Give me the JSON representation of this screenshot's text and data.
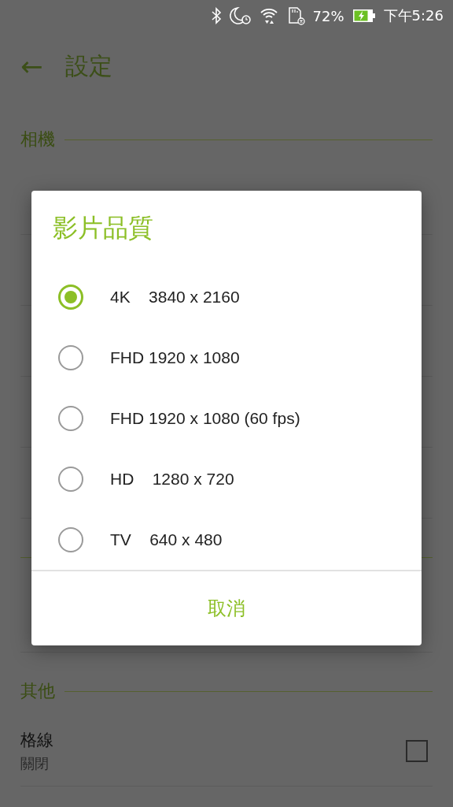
{
  "status_bar": {
    "battery_text": "72%",
    "time": "下午5:26"
  },
  "toolbar": {
    "back_icon": "←",
    "title": "設定"
  },
  "sections": [
    {
      "title": "相機"
    },
    {
      "title": "其他",
      "rows": [
        {
          "title": "格線",
          "value": "關閉",
          "kind": "checkbox",
          "checked": false
        }
      ]
    }
  ],
  "dialog": {
    "title": "影片品質",
    "options": [
      {
        "label": "4K    3840 x 2160",
        "selected": true
      },
      {
        "label": "FHD 1920 x 1080",
        "selected": false
      },
      {
        "label": "FHD 1920 x 1080 (60 fps)",
        "selected": false
      },
      {
        "label": "HD    1280 x 720",
        "selected": false
      },
      {
        "label": "TV    640 x 480",
        "selected": false
      }
    ],
    "cancel": "取消"
  }
}
